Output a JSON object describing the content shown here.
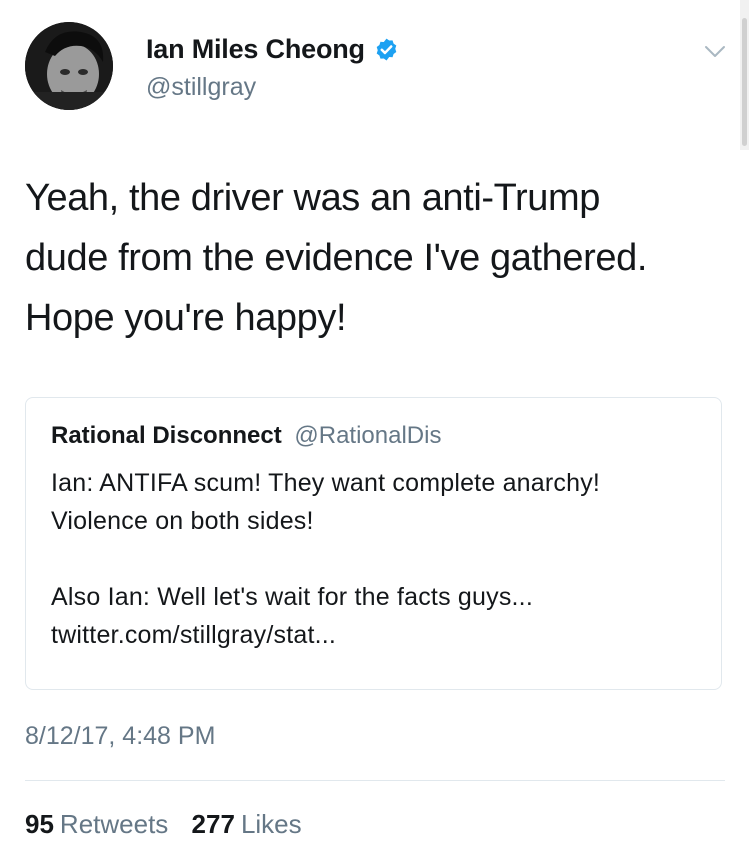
{
  "author": {
    "display_name": "Ian Miles Cheong",
    "handle": "@stillgray",
    "verified": true,
    "avatar_icon": "profile-photo"
  },
  "tweet": {
    "text": "Yeah, the driver was an anti-Trump\ndude from the evidence I've gathered.\nHope you're happy!",
    "timestamp": "8/12/17, 4:48 PM"
  },
  "quoted_tweet": {
    "display_name": "Rational Disconnect",
    "handle": "@RationalDis",
    "paragraph_1": "Ian: ANTIFA scum! They want complete anarchy! Violence on both sides!",
    "paragraph_2": "Also Ian: Well let's wait for the facts guys...",
    "link": "twitter.com/stillgray/stat..."
  },
  "stats": {
    "retweets_count": "95",
    "retweets_label": "Retweets",
    "likes_count": "277",
    "likes_label": "Likes"
  },
  "colors": {
    "primary_text": "#14171a",
    "secondary_text": "#657786",
    "verified_blue": "#1da1f2",
    "border": "#e1e8ed"
  }
}
